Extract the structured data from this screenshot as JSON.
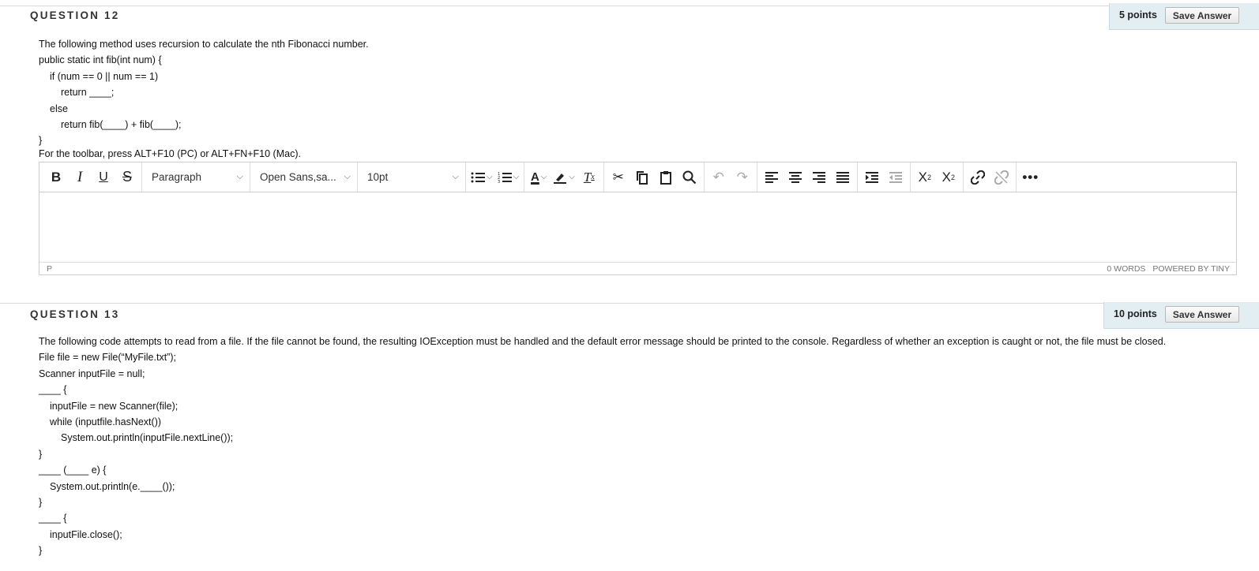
{
  "q12": {
    "title": "QUESTION 12",
    "points": "5 points",
    "save_label": "Save Answer",
    "lines": [
      "The following method uses recursion to calculate the nth Fibonacci number.",
      "public static int fib(int num) {",
      "if (num == 0 || num == 1)",
      "return ____;",
      "else",
      "return fib(____) + fib(____);",
      "}"
    ],
    "toolbar_hint": "For the toolbar, press ALT+F10 (PC) or ALT+FN+F10 (Mac).",
    "editor": {
      "block_format": "Paragraph",
      "font_family": "Open Sans,sa...",
      "font_size": "10pt",
      "path": "P",
      "word_count": "0 WORDS",
      "powered_by": "POWERED BY TINY"
    }
  },
  "q13": {
    "title": "QUESTION 13",
    "points": "10 points",
    "save_label": "Save Answer",
    "lines": [
      "The following code attempts to read from a file. If the file cannot be found, the resulting IOException must be handled and the default error message should be printed to the console. Regardless of whether an exception is caught or not, the file must be closed.",
      "File file = new File(“MyFile.txt”);",
      "Scanner inputFile = null;",
      "____ {",
      "inputFile = new Scanner(file);",
      "while (inputfile.hasNext())",
      "System.out.println(inputFile.nextLine());",
      "}",
      "____ (____ e) {",
      "System.out.println(e.____());",
      "}",
      "____ {",
      "inputFile.close();",
      "}"
    ]
  },
  "icons": [
    "bold-icon",
    "italic-icon",
    "underline-icon",
    "strikethrough-icon",
    "bullet-list-icon",
    "numbered-list-icon",
    "text-color-icon",
    "highlight-icon",
    "clear-formatting-icon",
    "cut-icon",
    "copy-icon",
    "paste-icon",
    "search-icon",
    "undo-icon",
    "redo-icon",
    "align-left-icon",
    "align-center-icon",
    "align-right-icon",
    "justify-icon",
    "indent-icon",
    "outdent-icon",
    "superscript-icon",
    "subscript-icon",
    "link-icon",
    "unlink-icon",
    "more-icon"
  ]
}
